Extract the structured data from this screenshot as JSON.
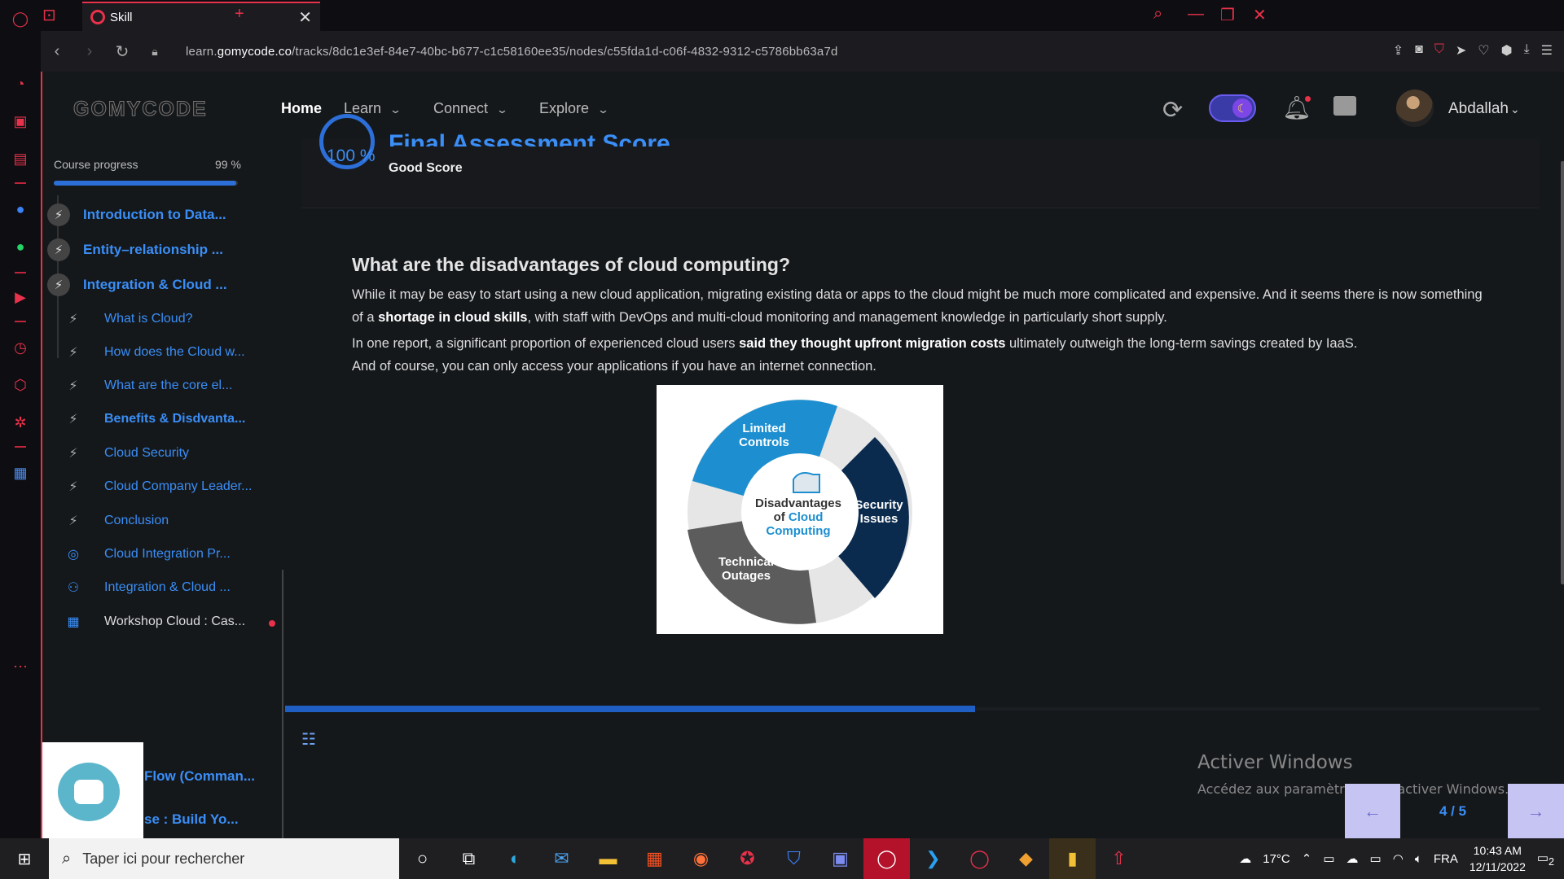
{
  "browser": {
    "tab_title": "Skill",
    "url_prefix": "learn.",
    "url_domain": "gomycode.co",
    "url_path": "/tracks/8dc1e3ef-84e7-40bc-b677-c1c58160ee35/nodes/c55fda1d-c06f-4832-9312-c5786bb63a7d"
  },
  "nav": {
    "logo": "GOMYCODE",
    "home": "Home",
    "learn": "Learn",
    "connect": "Connect",
    "explore": "Explore",
    "username": "Abdallah"
  },
  "sidebar": {
    "progress_label": "Course progress",
    "progress_value": "99 %",
    "progress_fraction": 0.99,
    "modules": [
      {
        "label": "Introduction to Data..."
      },
      {
        "label": "Entity–relationship ..."
      },
      {
        "label": "Integration & Cloud ..."
      }
    ],
    "lessons": [
      {
        "label": "What is Cloud?",
        "icon": "bolt-icon"
      },
      {
        "label": "How does the Cloud w...",
        "icon": "bolt-icon"
      },
      {
        "label": "What are the core el...",
        "icon": "bolt-icon"
      },
      {
        "label": "Benefits & Disdvanta...",
        "icon": "bolt-icon",
        "active": true
      },
      {
        "label": "Cloud Security",
        "icon": "bolt-icon"
      },
      {
        "label": "Cloud Company Leader...",
        "icon": "bolt-icon"
      },
      {
        "label": "Conclusion",
        "icon": "bolt-icon"
      },
      {
        "label": "Cloud Integration Pr...",
        "icon": "target-icon"
      },
      {
        "label": "Integration & Cloud ...",
        "icon": "people-icon"
      },
      {
        "label": "Workshop Cloud : Cas...",
        "icon": "workshop-icon"
      }
    ],
    "partial_items": [
      "Flow (Comman...",
      "se : Build Yo..."
    ]
  },
  "score": {
    "percent": "100 %",
    "title": "Final Assessment Score",
    "label": "Good Score"
  },
  "lesson": {
    "heading": "What are the disadvantages of cloud computing?",
    "p1_a": "While it may be easy to start using a new cloud application, migrating existing data or apps to the cloud might be much more complicated and expensive. And it seems there is now something of a ",
    "p1_bold": "shortage in cloud skills",
    "p1_b": ", with staff with DevOps and multi-cloud monitoring and management knowledge in particularly short supply.",
    "p2_a": "In one report, a significant proportion of experienced cloud users ",
    "p2_bold": "said they thought upfront migration costs",
    "p2_b": " ultimately outweigh the long-term savings created by IaaS.",
    "p3": "And of course, you can only access your applications if you have an internet connection.",
    "diagram": {
      "center_1": "Disadvantages",
      "center_2a": "of ",
      "center_2b": "Cloud",
      "center_3": "Computing",
      "seg_1a": "Limited",
      "seg_1b": "Controls",
      "seg_2a": "Security",
      "seg_2b": "Issues",
      "seg_3a": "Technical",
      "seg_3b": "Outages"
    }
  },
  "pager": {
    "counter": "4 / 5",
    "progress_fraction": 0.55
  },
  "windows_activation": {
    "title": "Activer Windows",
    "subtitle": "Accédez aux paramètres pour activer Windows."
  },
  "taskbar": {
    "search_placeholder": "Taper ici pour rechercher",
    "temperature": "17°C",
    "language": "FRA",
    "time": "10:43 AM",
    "date": "12/11/2022",
    "notification_count": "2"
  },
  "colors": {
    "accent_blue": "#3a8ef6",
    "opera_red": "#e8314a",
    "bg": "#15181b"
  }
}
